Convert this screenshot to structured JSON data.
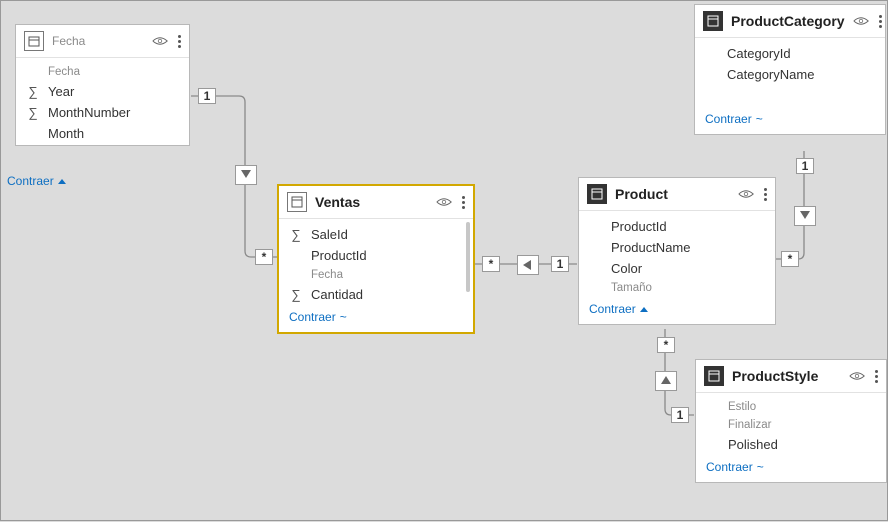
{
  "tables": {
    "fecha": {
      "title": "Fecha",
      "fields": [
        {
          "name": "Fecha",
          "sigma": false,
          "dim": true
        },
        {
          "name": "Year",
          "sigma": true,
          "dim": false
        },
        {
          "name": "MonthNumber",
          "sigma": true,
          "dim": false
        },
        {
          "name": "Month",
          "sigma": false,
          "dim": false
        }
      ],
      "collapse_label": "Contraer"
    },
    "ventas": {
      "title": "Ventas",
      "fields": [
        {
          "name": "SaleId",
          "sigma": true,
          "dim": false
        },
        {
          "name": "ProductId",
          "sigma": false,
          "dim": false
        },
        {
          "name": "Fecha",
          "sigma": false,
          "dim": true
        },
        {
          "name": "Cantidad",
          "sigma": true,
          "dim": false
        }
      ],
      "collapse_label": "Contraer"
    },
    "product": {
      "title": "Product",
      "fields": [
        {
          "name": "ProductId",
          "sigma": false,
          "dim": false
        },
        {
          "name": "ProductName",
          "sigma": false,
          "dim": false
        },
        {
          "name": "Color",
          "sigma": false,
          "dim": false
        },
        {
          "name": "Tamaño",
          "sigma": false,
          "dim": true
        }
      ],
      "collapse_label": "Contraer"
    },
    "productCategory": {
      "title": "ProductCategory",
      "fields": [
        {
          "name": "CategoryId",
          "sigma": false,
          "dim": false
        },
        {
          "name": "CategoryName",
          "sigma": false,
          "dim": false
        }
      ],
      "collapse_label": "Contraer"
    },
    "productStyle": {
      "title": "ProductStyle",
      "fields": [
        {
          "name": "Estilo",
          "sigma": false,
          "dim": true
        },
        {
          "name": "Finalizar",
          "sigma": false,
          "dim": true
        },
        {
          "name": "Polished",
          "sigma": false,
          "dim": false
        }
      ],
      "collapse_label": "Contraer"
    }
  },
  "relationships": [
    {
      "from": "fecha",
      "to": "ventas",
      "from_card": "1",
      "to_card": "*",
      "direction": "down"
    },
    {
      "from": "ventas",
      "to": "product",
      "from_card": "*",
      "to_card": "1",
      "direction": "right"
    },
    {
      "from": "productCategory",
      "to": "product",
      "from_card": "1",
      "to_card": "*",
      "direction": "down"
    },
    {
      "from": "productStyle",
      "to": "product",
      "from_card": "1",
      "to_card": "*",
      "direction": "up"
    }
  ],
  "glyphs": {
    "sigma": "∑",
    "one": "1",
    "many": "*"
  }
}
